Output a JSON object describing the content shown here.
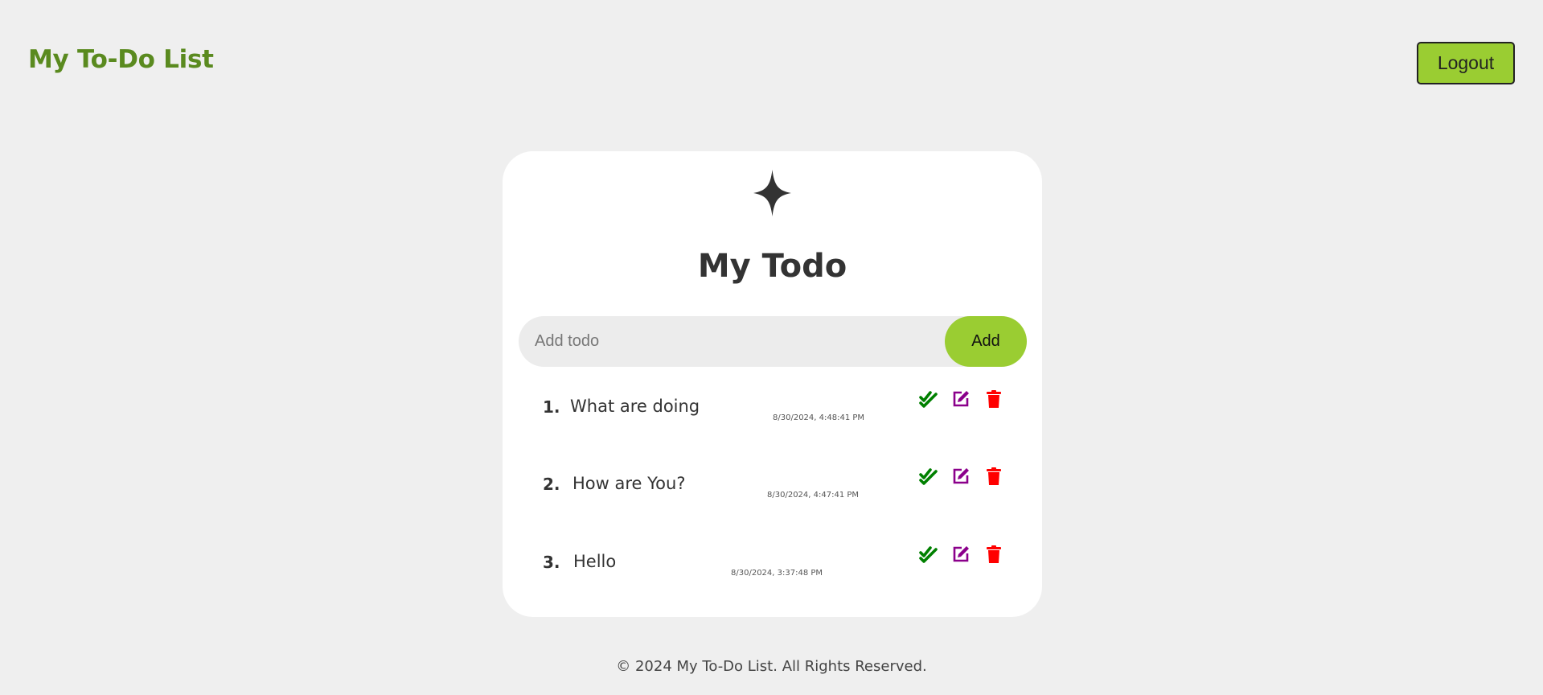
{
  "header": {
    "brand": "My To-Do List",
    "logout_label": "Logout"
  },
  "card": {
    "icon": "star-icon",
    "title": "My Todo",
    "input_placeholder": "Add todo",
    "input_value": "",
    "add_label": "Add"
  },
  "todos": [
    {
      "number": "1.",
      "text": "What are doing",
      "timestamp": "8/30/2024, 4:48:41 PM"
    },
    {
      "number": "2.",
      "text": "How are You?",
      "timestamp": "8/30/2024, 4:47:41 PM"
    },
    {
      "number": "3.",
      "text": "Hello",
      "timestamp": "8/30/2024, 3:37:48 PM"
    }
  ],
  "item_icons": [
    "double-check-icon",
    "edit-icon",
    "trash-icon"
  ],
  "colors": {
    "brand": "#5a8a1f",
    "accent": "#9acd32",
    "check": "#008000",
    "edit": "#8b008b",
    "delete": "#ff0000",
    "background": "#efefef"
  },
  "footer": {
    "text": "© 2024 My To-Do List. All Rights Reserved."
  }
}
